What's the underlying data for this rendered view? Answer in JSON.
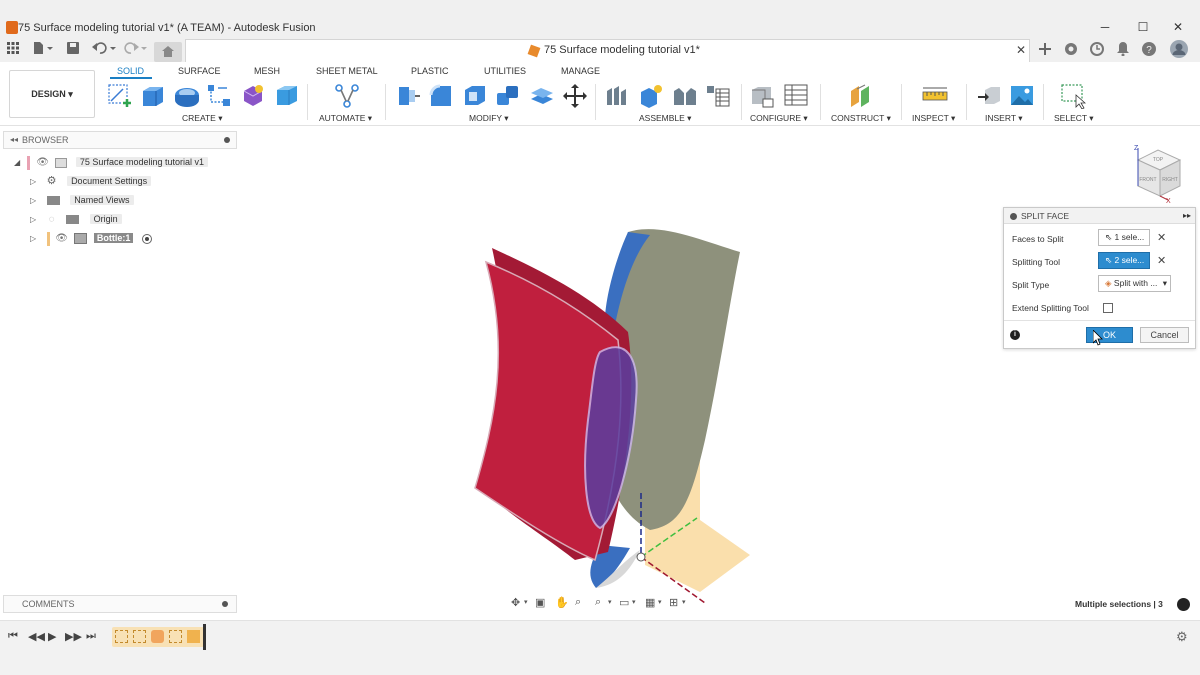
{
  "window": {
    "title": "75 Surface modeling tutorial v1* (A TEAM) - Autodesk Fusion",
    "minimize": "─",
    "maximize": "☐",
    "close": "✕"
  },
  "doc_tab": {
    "label": "75 Surface modeling tutorial v1*",
    "close": "✕"
  },
  "workspace": {
    "label": "DESIGN ▾"
  },
  "tabs": [
    "SOLID",
    "SURFACE",
    "MESH",
    "SHEET METAL",
    "PLASTIC",
    "UTILITIES",
    "MANAGE"
  ],
  "groups": {
    "create": "CREATE ▾",
    "automate": "AUTOMATE ▾",
    "modify": "MODIFY ▾",
    "assemble": "ASSEMBLE ▾",
    "configure": "CONFIGURE ▾",
    "construct": "CONSTRUCT ▾",
    "inspect": "INSPECT ▾",
    "insert": "INSERT ▾",
    "select": "SELECT ▾"
  },
  "browser": {
    "title": "BROWSER",
    "items": [
      {
        "label": "75 Surface modeling tutorial v1"
      },
      {
        "label": "Document Settings"
      },
      {
        "label": "Named Views"
      },
      {
        "label": "Origin"
      },
      {
        "label": "Bottle:1"
      }
    ]
  },
  "comments": {
    "title": "COMMENTS"
  },
  "split_face": {
    "title": "SPLIT FACE",
    "faces_to_split": {
      "label": "Faces to Split",
      "value": "1 sele..."
    },
    "splitting_tool": {
      "label": "Splitting Tool",
      "value": "2 sele..."
    },
    "split_type": {
      "label": "Split Type",
      "value": "Split with ..."
    },
    "extend": {
      "label": "Extend Splitting Tool",
      "checked": false
    },
    "ok": "OK",
    "cancel": "Cancel"
  },
  "status": {
    "text": "Multiple selections | 3"
  },
  "viewcube": {
    "front": "FRONT",
    "right": "RIGHT",
    "top": "TOP",
    "x": "X",
    "z": "Z"
  },
  "colors": {
    "accent": "#1a7fc4",
    "selected_tool": "#2d8ccf",
    "red_surface": "#b81c3a",
    "blue_surface": "#3a6fc0",
    "grey_surface": "#8e917c",
    "sketch_plane": "#f5c568"
  }
}
